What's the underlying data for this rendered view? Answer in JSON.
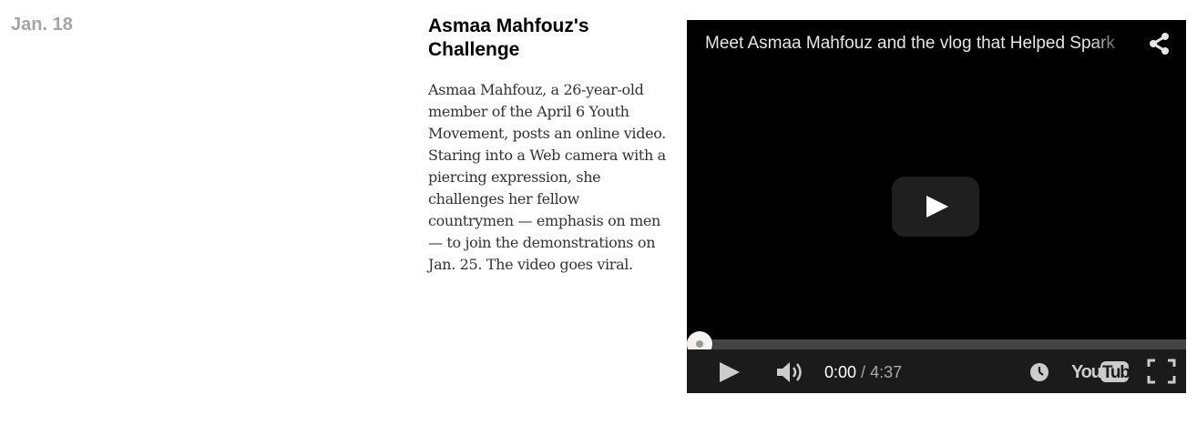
{
  "entry": {
    "date": "Jan. 18",
    "headline": "Asmaa Mahfouz's Challenge",
    "body": "Asmaa Mahfouz, a 26-year-old member of the April 6 Youth Movement, posts an online video. Staring into a Web camera with a piercing expression, she challenges her fellow countrymen — emphasis on men — to join the demonstrations on Jan. 25. The video goes viral."
  },
  "video": {
    "title": "Meet Asmaa Mahfouz and the vlog that Helped Spark",
    "current_time": "0:00",
    "separator": " / ",
    "duration": "4:37",
    "progress_fraction": 0.0,
    "brand": "YouTube",
    "icons": {
      "share": "share-icon",
      "big_play": "play-icon",
      "play": "play-icon",
      "volume": "volume-icon",
      "watch_later": "clock-icon",
      "fullscreen": "fullscreen-icon"
    },
    "colors": {
      "progress_played": "#cc181e",
      "controls_bg": "#1b1b1b",
      "player_bg": "#000000"
    }
  }
}
